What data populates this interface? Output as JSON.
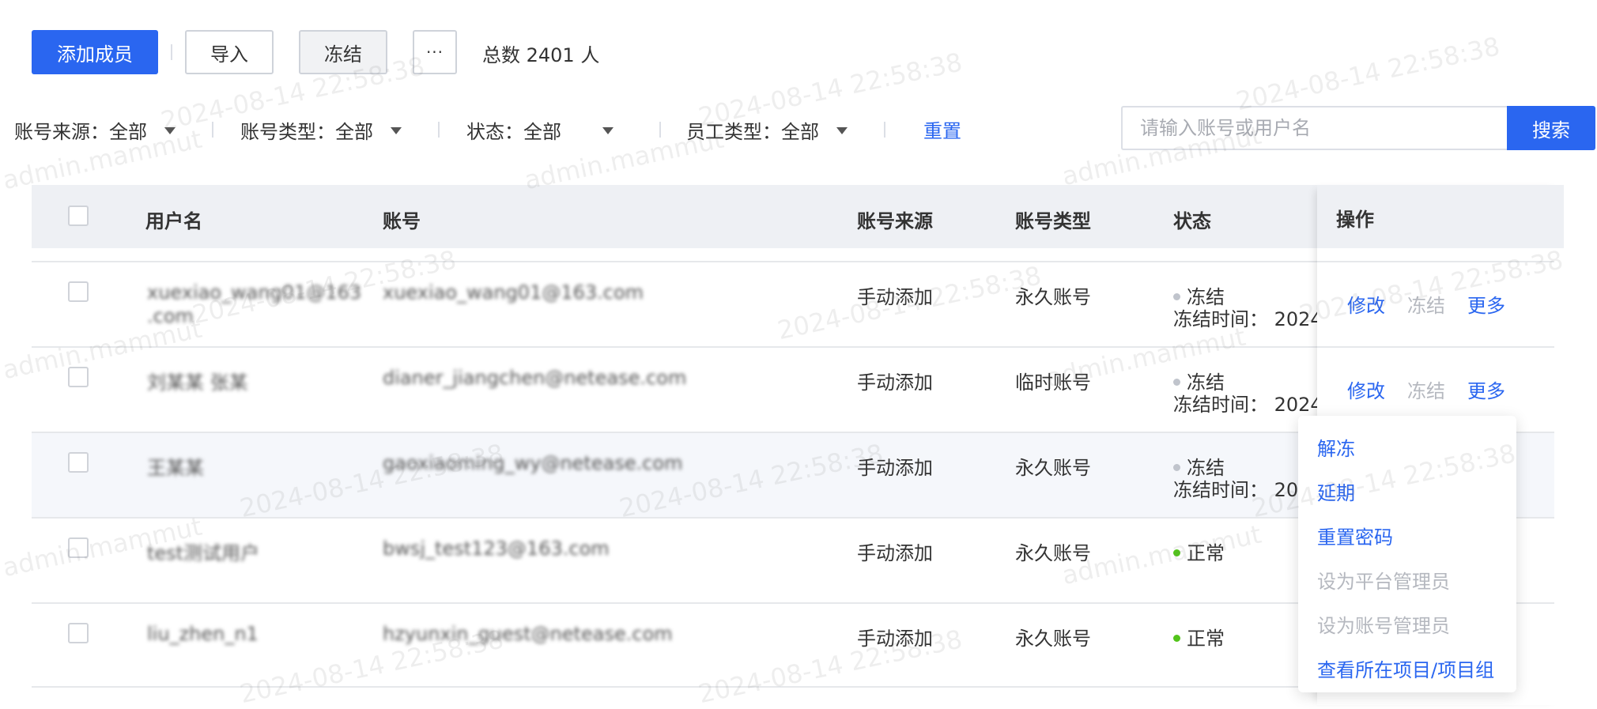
{
  "toolbar": {
    "add_member_label": "添加成员",
    "import_label": "导入",
    "freeze_label": "冻结",
    "more_label": "···",
    "total_text": "总数 2401 人"
  },
  "filters": {
    "account_source": {
      "label": "账号来源：",
      "value": "全部"
    },
    "account_type": {
      "label": "账号类型：",
      "value": "全部"
    },
    "status": {
      "label": "状态：",
      "value": "全部"
    },
    "employee_type": {
      "label": "员工类型：",
      "value": "全部"
    },
    "reset_label": "重置",
    "search_placeholder": "请输入账号或用户名",
    "search_label": "搜索"
  },
  "table": {
    "headers": {
      "username": "用户名",
      "account": "账号",
      "source": "账号来源",
      "type": "账号类型",
      "status": "状态",
      "operation": "操作"
    },
    "rows": [
      {
        "username": "xuexiao_wang01@163",
        "username2": ".com",
        "account": "xuexiao_wang01@163.com",
        "source": "手动添加",
        "type": "永久账号",
        "status": "冻结",
        "status_color": "#c0c4cc",
        "freeze_time": "冻结时间： 2024"
      },
      {
        "username": "刘某某 张某",
        "account": "dianer_jiangchen@netease.com",
        "source": "手动添加",
        "type": "临时账号",
        "status": "冻结",
        "status_color": "#c0c4cc",
        "freeze_time": "冻结时间： 2024"
      },
      {
        "username": "王某某",
        "account": "gaoxiaoming_wy@netease.com",
        "source": "手动添加",
        "type": "永久账号",
        "status": "冻结",
        "status_color": "#c0c4cc",
        "freeze_time": "冻结时间： 20"
      },
      {
        "username": "test测试用户",
        "account": "bwsj_test123@163.com",
        "source": "手动添加",
        "type": "永久账号",
        "status": "正常",
        "status_color": "#52c41a"
      },
      {
        "username": "liu_zhen_n1",
        "account": "hzyunxin_guest@netease.com",
        "source": "手动添加",
        "type": "永久账号",
        "status": "正常",
        "status_color": "#52c41a"
      }
    ],
    "ops": {
      "edit": "修改",
      "freeze": "冻结",
      "more": "更多"
    }
  },
  "more_menu": {
    "items": [
      {
        "label": "解冻",
        "enabled": true
      },
      {
        "label": "延期",
        "enabled": true
      },
      {
        "label": "重置密码",
        "enabled": true
      },
      {
        "label": "设为平台管理员",
        "enabled": false
      },
      {
        "label": "设为账号管理员",
        "enabled": false
      },
      {
        "label": "查看所在项目/项目组",
        "enabled": true
      }
    ]
  },
  "watermark": {
    "user": "admin.mammut",
    "time": "2024-08-14 22:58:38"
  },
  "colors": {
    "primary": "#2a66f0",
    "header_bg": "#eef0f4",
    "disabled": "#b5b8bf",
    "normal_dot": "#52c41a",
    "frozen_dot": "#c0c4cc"
  }
}
